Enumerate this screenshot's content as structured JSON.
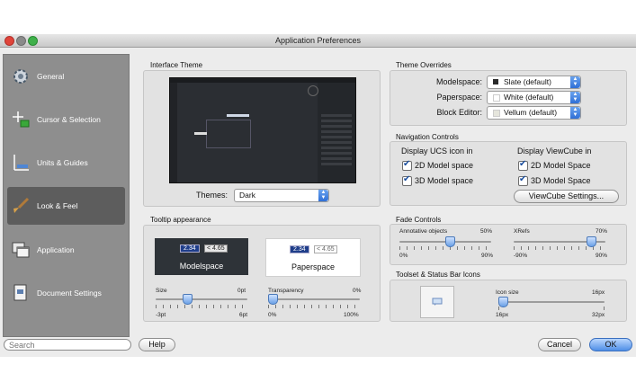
{
  "window": {
    "title": "Application Preferences"
  },
  "sidebar": {
    "items": [
      {
        "label": "General",
        "icon": "gear-icon"
      },
      {
        "label": "Cursor & Selection",
        "icon": "crosshair-icon"
      },
      {
        "label": "Units & Guides",
        "icon": "ruler-icon"
      },
      {
        "label": "Look & Feel",
        "icon": "brush-icon",
        "selected": true
      },
      {
        "label": "Application",
        "icon": "windows-icon"
      },
      {
        "label": "Document Settings",
        "icon": "document-icon"
      }
    ]
  },
  "interface_theme": {
    "title": "Interface Theme",
    "themes_label": "Themes:",
    "themes_value": "Dark"
  },
  "tooltip": {
    "title": "Tooltip appearance",
    "modelspace": {
      "value": "2.34",
      "compare": "< 4.65",
      "label": "Modelspace"
    },
    "paperspace": {
      "value": "2.34",
      "compare": "< 4.65",
      "label": "Paperspace"
    },
    "size": {
      "label": "Size",
      "current": "0pt",
      "min": "-3pt",
      "max": "6pt",
      "level": 0.33
    },
    "transparency": {
      "label": "Transparency",
      "current": "0%",
      "min": "0%",
      "max": "100%",
      "level": 0.0
    }
  },
  "theme_overrides": {
    "title": "Theme Overrides",
    "rows": [
      {
        "label": "Modelspace:",
        "value": "Slate (default)",
        "swatch": "#2a2a2a"
      },
      {
        "label": "Paperspace:",
        "value": "White (default)",
        "swatch": "#ffffff"
      },
      {
        "label": "Block Editor:",
        "value": "Vellum (default)",
        "swatch": "#e5e5dc"
      }
    ]
  },
  "navigation": {
    "title": "Navigation Controls",
    "ucs_heading": "Display UCS icon in",
    "ucs_2d": "2D Model space",
    "ucs_3d": "3D Model space",
    "cube_heading": "Display ViewCube in",
    "cube_2d": "2D Model Space",
    "cube_3d": "3D Model Space",
    "cube_settings": "ViewCube Settings..."
  },
  "fade": {
    "title": "Fade Controls",
    "annotative": {
      "label": "Annotative objects",
      "current": "50%",
      "min": "0%",
      "max": "90%",
      "level": 0.56
    },
    "xrefs": {
      "label": "XRefs",
      "current": "70%",
      "min": "-90%",
      "max": "90%",
      "level": 0.89
    }
  },
  "toolset": {
    "title": "Toolset & Status Bar Icons",
    "icon_size": {
      "label": "Icon size",
      "current": "16px",
      "min": "16px",
      "max": "32px",
      "level": 0.0
    }
  },
  "footer": {
    "search_placeholder": "Search",
    "help": "Help",
    "cancel": "Cancel",
    "ok": "OK"
  }
}
